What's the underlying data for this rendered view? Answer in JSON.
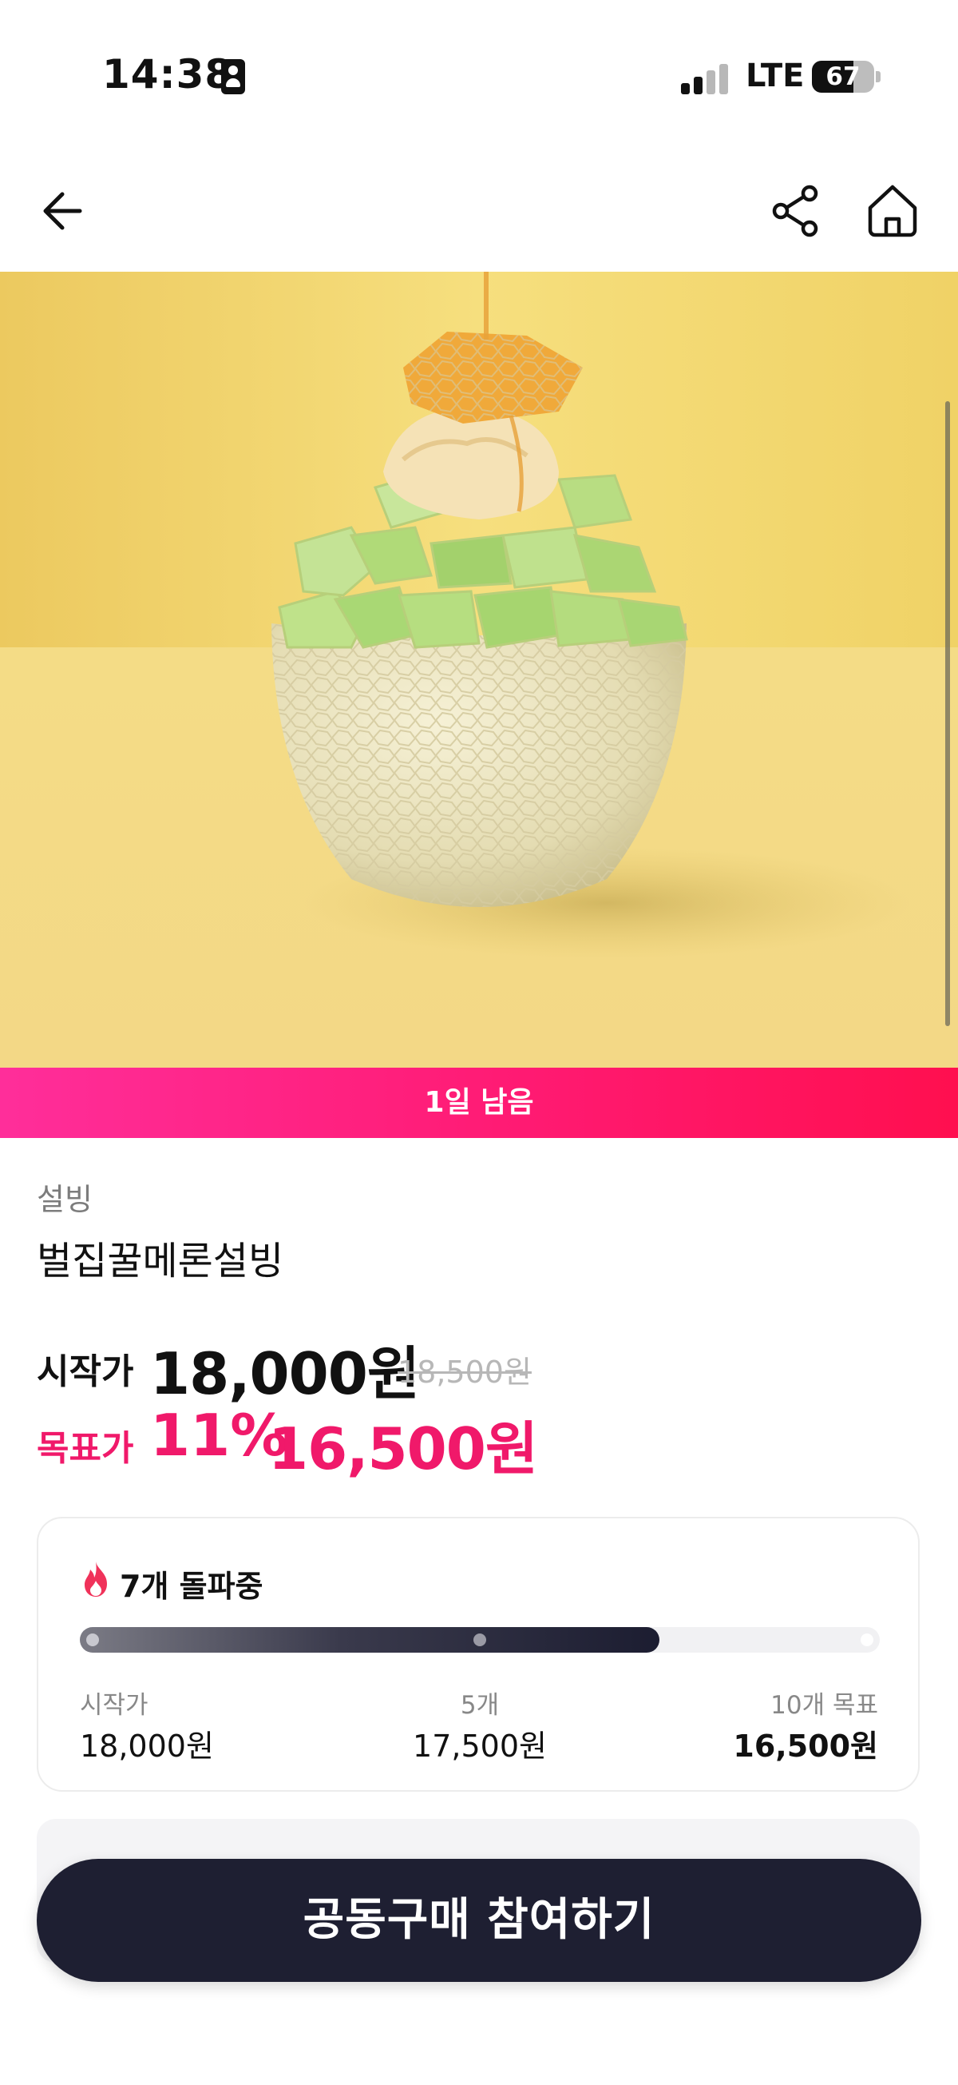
{
  "status_bar": {
    "time": "14:38",
    "network": "LTE",
    "battery": "67",
    "battery_level": 0.67
  },
  "header": {
    "back_icon": "arrow-left-icon",
    "share_icon": "share-icon",
    "home_icon": "home-icon"
  },
  "hero": {
    "icon": "product-photo"
  },
  "countdown": {
    "label": "1일 남음"
  },
  "product": {
    "category": "설빙",
    "name": "벌집꿀메론설빙",
    "start_label": "시작가",
    "start_price": "18,000원",
    "original_price": "18,500원",
    "target_label": "목표가",
    "target_rate": "11%",
    "target_price": "16,500원"
  },
  "progress": {
    "status": "7개 돌파중",
    "fill_fraction": 0.725,
    "ticks": [
      {
        "label": "시작가",
        "price": "18,000원"
      },
      {
        "label": "5개",
        "price": "17,500원"
      },
      {
        "label": "10개 목표",
        "price": "16,500원"
      }
    ]
  },
  "cta": {
    "label": "공동구매 참여하기"
  },
  "colors": {
    "accent": "#f0196a",
    "dark": "#1e1f32",
    "banner_start": "#ff2e9a",
    "banner_end": "#ff0f4f"
  }
}
